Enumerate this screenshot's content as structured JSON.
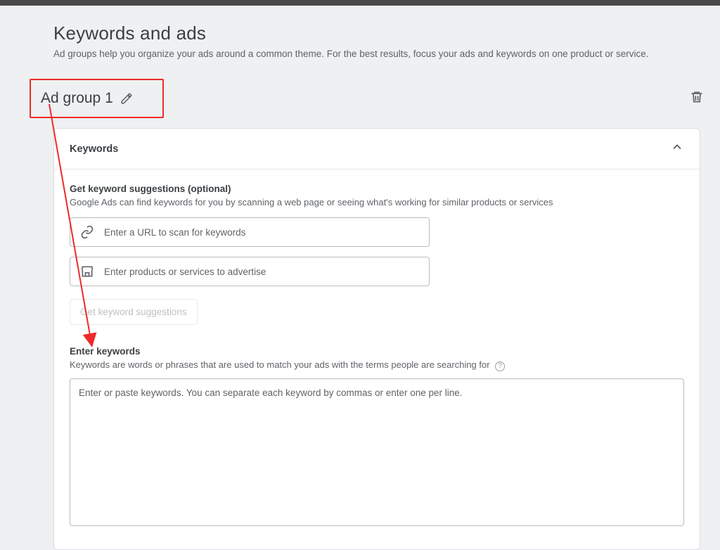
{
  "header": {
    "title": "Keywords and ads",
    "subtitle": "Ad groups help you organize your ads around a common theme. For the best results, focus your ads and keywords on one product or service."
  },
  "adgroup": {
    "name": "Ad group 1"
  },
  "card": {
    "title": "Keywords"
  },
  "suggestions": {
    "title": "Get keyword suggestions (optional)",
    "subtitle": "Google Ads can find keywords for you by scanning a web page or seeing what's working for similar products or services",
    "url_placeholder": "Enter a URL to scan for keywords",
    "product_placeholder": "Enter products or services to advertise",
    "button_label": "Get keyword suggestions"
  },
  "enter_keywords": {
    "title": "Enter keywords",
    "subtitle": "Keywords are words or phrases that are used to match your ads with the terms people are searching for",
    "placeholder": "Enter or paste keywords. You can separate each keyword by commas or enter one per line."
  }
}
